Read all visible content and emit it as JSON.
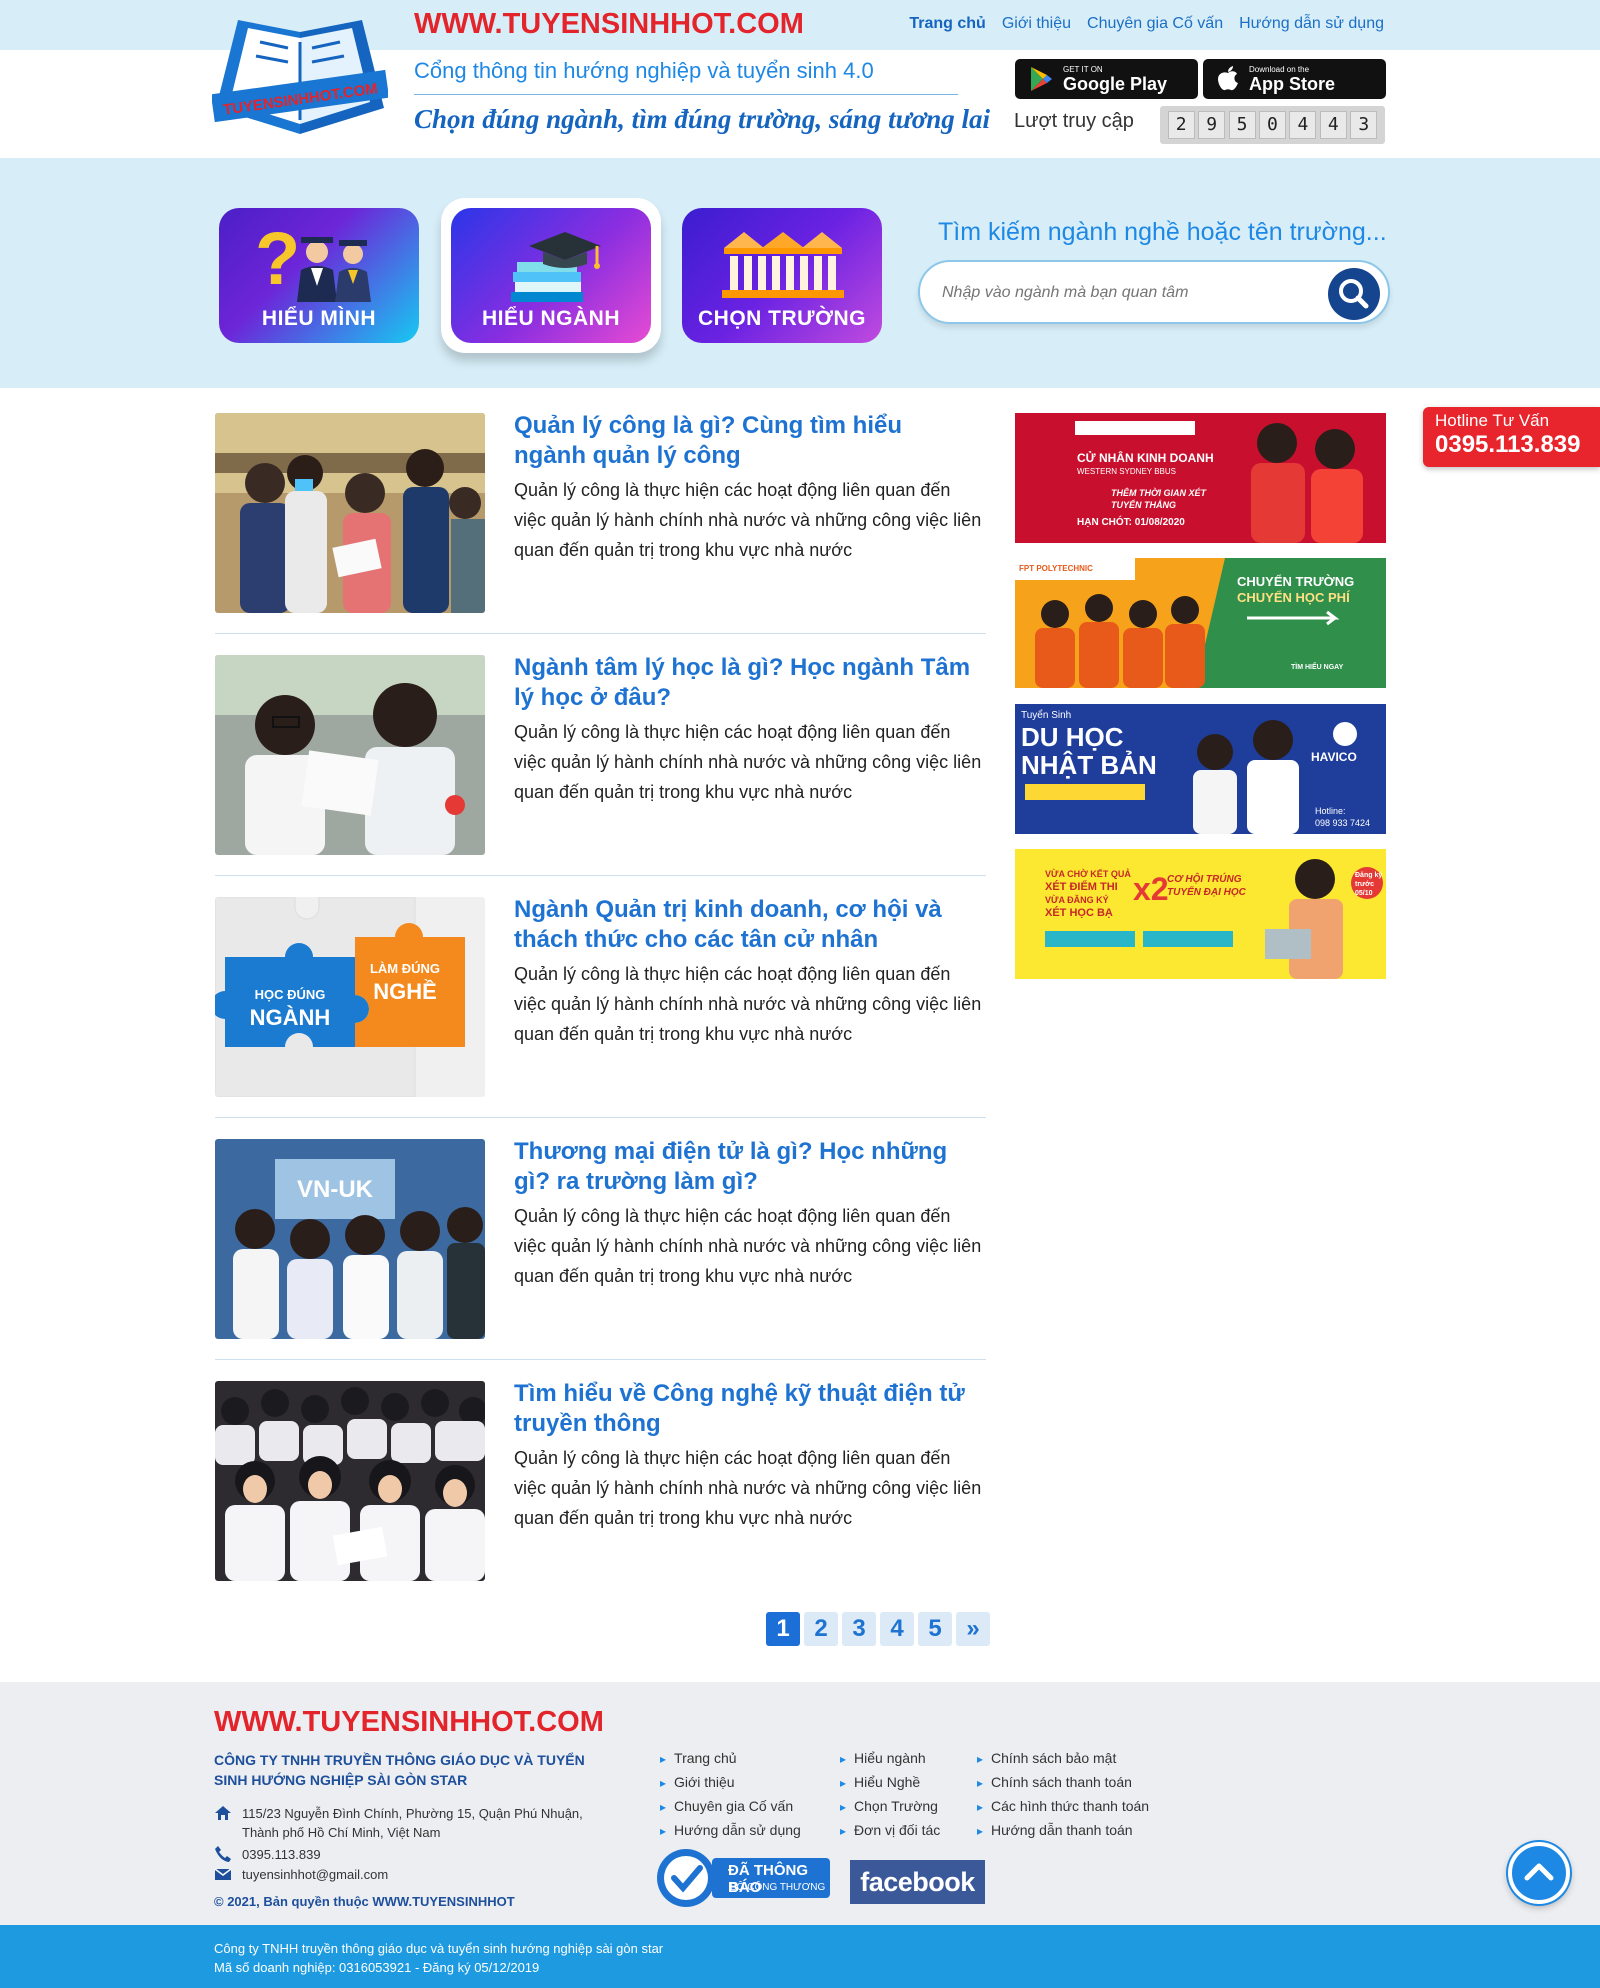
{
  "header": {
    "site_url": "WWW.TUYENSINHHOT.COM",
    "logo_text": "TUYENSINHHOT.COM",
    "nav": [
      "Trang chủ",
      "Giới thiệu",
      "Chuyên gia Cố vấn",
      "Hướng dẫn sử dụng"
    ],
    "tagline": "Cổng thông tin hướng nghiệp và tuyển sinh 4.0",
    "slogan": "Chọn đúng ngành, tìm đúng trường, sáng tương lai",
    "google_play": {
      "small": "GET IT ON",
      "big": "Google Play"
    },
    "app_store": {
      "small": "Download on the",
      "big": "App Store"
    },
    "visits_label": "Lượt truy cập",
    "visit_digits": [
      "2",
      "9",
      "5",
      "0",
      "4",
      "4",
      "3"
    ]
  },
  "hero": {
    "tiles": [
      "HIỂU MÌNH",
      "HIỂU NGÀNH",
      "CHỌN TRƯỜNG"
    ],
    "search_title": "Tìm kiếm ngành nghề hoặc tên trường...",
    "search_placeholder": "Nhập vào ngành mà bạn quan tâm"
  },
  "articles": [
    {
      "title": "Quản lý công là gì? Cùng tìm hiểu ngành quản lý công",
      "desc": "Quản lý công là thực hiện các hoạt động liên quan đến việc quản lý hành chính nhà nước và những công việc liên quan đến quản trị trong khu vực nhà nước"
    },
    {
      "title": "Ngành tâm lý học là gì? Học ngành Tâm lý học ở đâu?",
      "desc": "Quản lý công là thực hiện các hoạt động liên quan đến việc quản lý hành chính nhà nước và những công việc liên quan đến quản trị trong khu vực nhà nước"
    },
    {
      "title": "Ngành Quản trị kinh doanh, cơ hội và thách thức cho các tân cử nhân",
      "desc": "Quản lý công là thực hiện các hoạt động liên quan đến việc quản lý hành chính nhà nước và những công việc liên quan đến quản trị trong khu vực nhà nước"
    },
    {
      "title": "Thương mại điện tử là gì? Học những gì? ra trường làm gì?",
      "desc": "Quản lý công là thực hiện các hoạt động liên quan đến việc quản lý hành chính nhà nước và những công việc liên quan đến quản trị trong khu vực nhà nước"
    },
    {
      "title": "Tìm hiểu về Công nghệ kỹ thuật điện tử truyền thông",
      "desc": "Quản lý công là thực hiện các hoạt động liên quan đến việc quản lý hành chính nhà nước và những công việc liên quan đến quản trị trong khu vực nhà nước"
    }
  ],
  "puzzle": {
    "left_small": "HỌC ĐÚNG",
    "left_big": "NGÀNH",
    "right_small": "LÀM ĐÚNG",
    "right_big": "NGHỀ"
  },
  "thumb4_sign": "VN-UK",
  "pagination": [
    "1",
    "2",
    "3",
    "4",
    "5",
    "»"
  ],
  "banners": {
    "b1": {
      "l1": "CỬ NHÂN KINH DOANH",
      "l2": "WESTERN SYDNEY BBUS",
      "l3": "THÊM THỜI GIAN XÉT TUYỂN THẲNG",
      "l4": "HẠN CHÓT: 01/08/2020"
    },
    "b2": {
      "brand": "FPT POLYTECHNIC",
      "l1": "CHUYỂN TRƯỜNG",
      "l2": "CHUYỂN HỌC PHÍ",
      "l3": "TÌM HIỂU NGAY"
    },
    "b3": {
      "small": "Tuyển Sinh",
      "l1": "DU HỌC",
      "l2": "NHẬT BẢN",
      "brand": "HAVICO",
      "hotline": "Hotline:",
      "phone": "098 933 7424"
    },
    "b4": {
      "l1": "VỪA CHỜ KẾT QUẢ",
      "l2": "XÉT ĐIỂM THI",
      "l3": "VỪA ĐĂNG KÝ",
      "l4": "XÉT HỌC BẠ",
      "x2": "x2",
      "l5": "CƠ HỘI TRÚNG TUYỂN ĐẠI HỌC",
      "tag": "Đăng ký trước 05/10"
    }
  },
  "hotline": {
    "label": "Hotline Tư Vấn",
    "number": "0395.113.839"
  },
  "footer": {
    "url": "WWW.TUYENSINHHOT.COM",
    "company": "CÔNG TY TNHH TRUYỀN THÔNG GIÁO DỤC VÀ TUYỂN SINH HƯỚNG NGHIỆP SÀI GÒN STAR",
    "address1": "115/23 Nguyễn Đình Chính, Phường 15, Quận Phú Nhuận,",
    "address2": "Thành phố Hồ Chí Minh, Việt Nam",
    "phone": "0395.113.839",
    "email": "tuyensinhhot@gmail.com",
    "copyright": "© 2021, Bản quyền thuộc WWW.TUYENSINHHOT",
    "col1": [
      "Trang chủ",
      "Giới thiệu",
      "Chuyên gia Cố vấn",
      "Hướng dẫn sử dụng"
    ],
    "col2": [
      "Hiểu ngành",
      "Hiểu Nghề",
      "Chọn Trường",
      "Đơn vị đối tác"
    ],
    "col3": [
      "Chính sách bảo mật",
      "Chính sách thanh toán",
      "Các hình thức thanh toán",
      "Hướng dẫn thanh toán"
    ],
    "badge_l1": "ĐÃ THÔNG BÁO",
    "badge_l2": "BỘ CÔNG THƯƠNG",
    "facebook": "facebook",
    "bottom1": "Công ty TNHH truyền thông giáo dục và tuyển sinh hướng nghiệp sài gòn star",
    "bottom2": "Mã số doanh nghiệp: 0316053921 - Đăng ký 05/12/2019"
  },
  "colors": {
    "brand_red": "#e3242b",
    "brand_blue": "#1e73d2",
    "hero_bg": "#d7eef8",
    "footer_bar": "#1e9be0"
  }
}
